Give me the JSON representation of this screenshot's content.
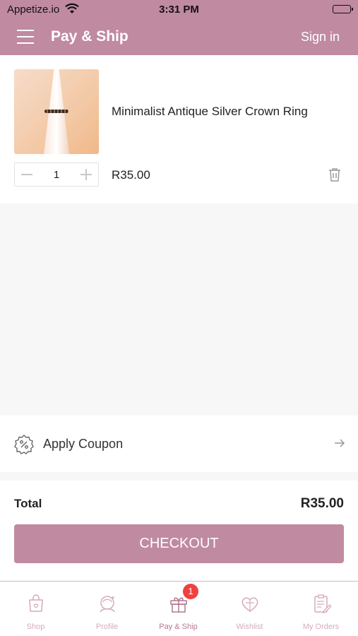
{
  "status_bar": {
    "carrier": "Appetize.io",
    "time": "3:31 PM"
  },
  "header": {
    "title": "Pay & Ship",
    "sign_in": "Sign in"
  },
  "cart_item": {
    "name": "Minimalist Antique Silver Crown Ring",
    "quantity": "1",
    "price": "R35.00"
  },
  "coupon": {
    "label": "Apply Coupon"
  },
  "summary": {
    "total_label": "Total",
    "total_value": "R35.00",
    "checkout_label": "CHECKOUT"
  },
  "tabs": [
    {
      "label": "Shop",
      "icon": "shopping-bag-icon"
    },
    {
      "label": "Profile",
      "icon": "profile-icon"
    },
    {
      "label": "Pay & Ship",
      "icon": "gift-icon",
      "badge": "1",
      "active": true
    },
    {
      "label": "Wishlist",
      "icon": "heart-gift-icon"
    },
    {
      "label": "My Orders",
      "icon": "orders-clipboard-icon"
    }
  ],
  "colors": {
    "brand": "#c08aa0",
    "badge": "#f04040",
    "tab_inactive": "#d4abbb",
    "tab_active": "#b07891"
  }
}
